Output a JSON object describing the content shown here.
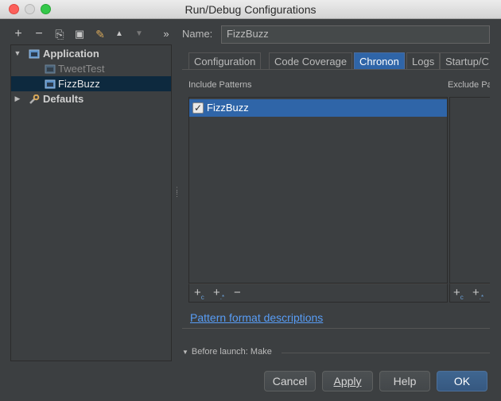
{
  "window": {
    "title": "Run/Debug Configurations"
  },
  "toolbar": {
    "buttons": [
      {
        "name": "add",
        "glyph": "+"
      },
      {
        "name": "remove",
        "glyph": "−"
      },
      {
        "name": "copy",
        "glyph": "⎘"
      },
      {
        "name": "save",
        "glyph": "▣"
      },
      {
        "name": "edit-defaults",
        "glyph": "✎"
      },
      {
        "name": "move-up",
        "glyph": "▲"
      },
      {
        "name": "move-down",
        "glyph": "▼"
      },
      {
        "name": "more",
        "glyph": "»"
      }
    ]
  },
  "tree": {
    "application": "Application",
    "tweettest": "TweetTest",
    "fizzbuzz": "FizzBuzz",
    "defaults": "Defaults"
  },
  "name_label": "Name:",
  "name_value": "FizzBuzz",
  "tabs": [
    "Configuration",
    "Code Coverage",
    "Chronon",
    "Logs",
    "Startup/C"
  ],
  "active_tab": "Chronon",
  "include_title": "Include Patterns",
  "exclude_title": "Exclude Patterns",
  "include_patterns": [
    {
      "label": "FizzBuzz",
      "checked": true
    }
  ],
  "list_tools": {
    "add_class": "+",
    "add_pattern": "+",
    "remove": "−"
  },
  "pattern_link": "Pattern format descriptions",
  "before_launch": "Before launch: Make",
  "buttons": {
    "cancel": "Cancel",
    "apply": "Apply",
    "help": "Help",
    "ok": "OK"
  },
  "colors": {
    "selection": "#2f65a8",
    "tree_selection": "#0d293e",
    "link": "#589df6",
    "background": "#3c3f41"
  }
}
